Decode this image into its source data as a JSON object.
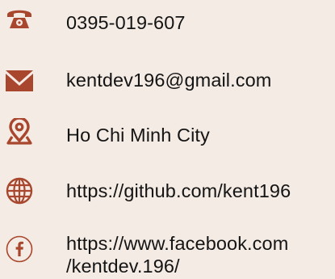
{
  "contacts": {
    "phone": {
      "icon": "phone-icon",
      "value": "0395-019-607"
    },
    "email": {
      "icon": "envelope-icon",
      "value": "kentdev196@gmail.com"
    },
    "location": {
      "icon": "map-pin-icon",
      "value": "Ho Chi Minh City"
    },
    "github": {
      "icon": "globe-icon",
      "value": "https://github.com/kent196"
    },
    "facebook": {
      "icon": "facebook-icon",
      "line1": "https://www.facebook.com",
      "line2": "/kentdev.196/"
    }
  },
  "colors": {
    "accent": "#a8472e",
    "background": "#f4ebe4",
    "text": "#141414"
  }
}
